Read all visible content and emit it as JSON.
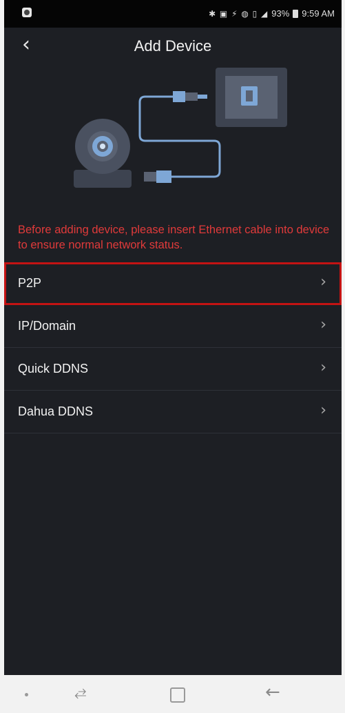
{
  "status_bar": {
    "icons_left": [
      "app-notification-icon"
    ],
    "icons_right": [
      "bluetooth-icon",
      "nfc-icon",
      "mute-icon",
      "data-saver-icon",
      "vibrate-icon",
      "signal-icon",
      "battery-icon"
    ],
    "battery_text": "93%",
    "time": "9:59 AM"
  },
  "header": {
    "title": "Add Device",
    "back_icon": "chevron-left-icon"
  },
  "illustration": {
    "name": "camera-ethernet-illustration",
    "colors": {
      "body": "#4a5160",
      "accent": "#7ea7d6",
      "panel": "#3d4350"
    }
  },
  "warning": {
    "text": "Before adding device, please insert Ethernet cable into device to ensure normal network status.",
    "color": "#e03a3a"
  },
  "menu": {
    "items": [
      {
        "label": "P2P",
        "highlighted": true
      },
      {
        "label": "IP/Domain",
        "highlighted": false
      },
      {
        "label": "Quick DDNS",
        "highlighted": false
      },
      {
        "label": "Dahua DDNS",
        "highlighted": false
      }
    ],
    "chevron": "›"
  },
  "nav_bar": {
    "icons": [
      "nav-dot-icon",
      "recents-icon",
      "home-icon",
      "back-icon"
    ]
  },
  "colors": {
    "background": "#1d1f24",
    "highlight_border": "#c41313",
    "divider": "#2e3138"
  }
}
